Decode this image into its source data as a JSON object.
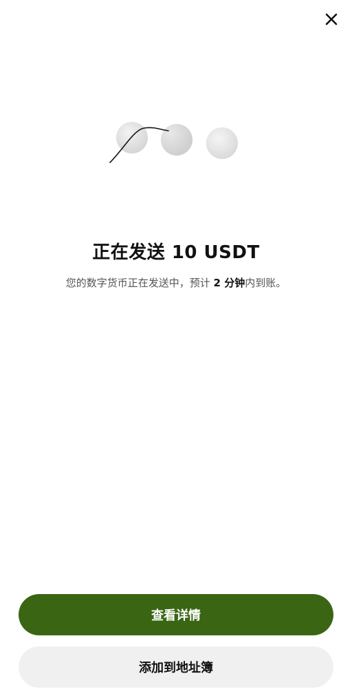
{
  "header": {
    "close_icon": "close-icon"
  },
  "status": {
    "title": "正在发送 10 USDT",
    "subtitle_before": "您的数字货币正在发送中，预计 ",
    "subtitle_emphasis": "2 分钟",
    "subtitle_after": "内到账。"
  },
  "actions": {
    "view_details_label": "查看详情",
    "add_address_book_label": "添加到地址簿"
  },
  "colors": {
    "primary_button": "#3a6614",
    "secondary_button": "#f0f0f0"
  }
}
